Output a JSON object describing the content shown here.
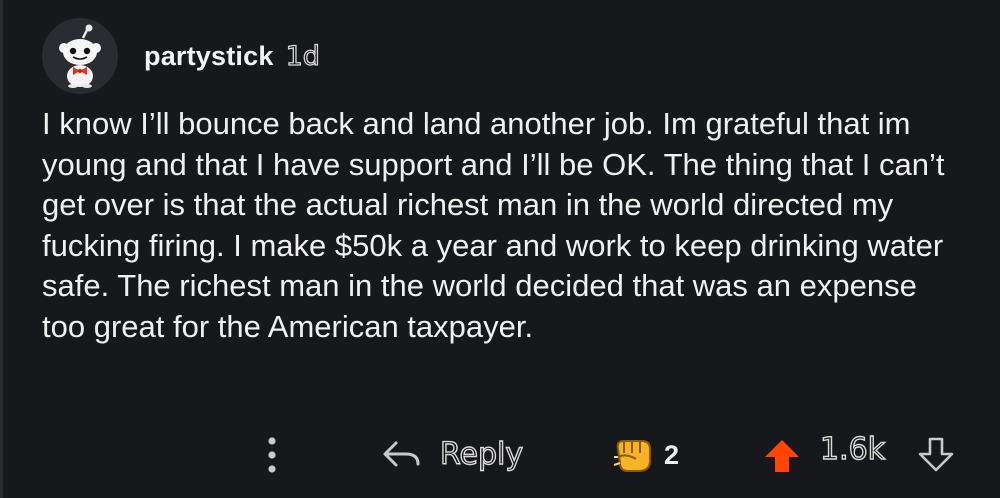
{
  "comment": {
    "username": "partystick",
    "timestamp": "1d",
    "avatar": "reddit-snoo-icon",
    "body": "I know I’ll bounce back and land another job. Im grateful that im young and that I have support and I’ll be OK. The thing that I can’t get over is that the actual richest man in the world directed my fucking firing. I make $50k a year and work to keep drinking water safe. The richest man in the world decided that was an expense too great for the American taxpayer."
  },
  "actions": {
    "more_icon": "more-vertical-icon",
    "reply_icon": "reply-arrow-icon",
    "reply_label": "Reply",
    "award_icon": "fist-bump-award-icon",
    "award_count": "2",
    "upvote_icon": "upvote-arrow-icon",
    "vote_count": "1.6k",
    "downvote_icon": "downvote-arrow-icon"
  },
  "colors": {
    "background": "#17181b",
    "upvote": "#ff4500",
    "award": "#f5b325"
  }
}
